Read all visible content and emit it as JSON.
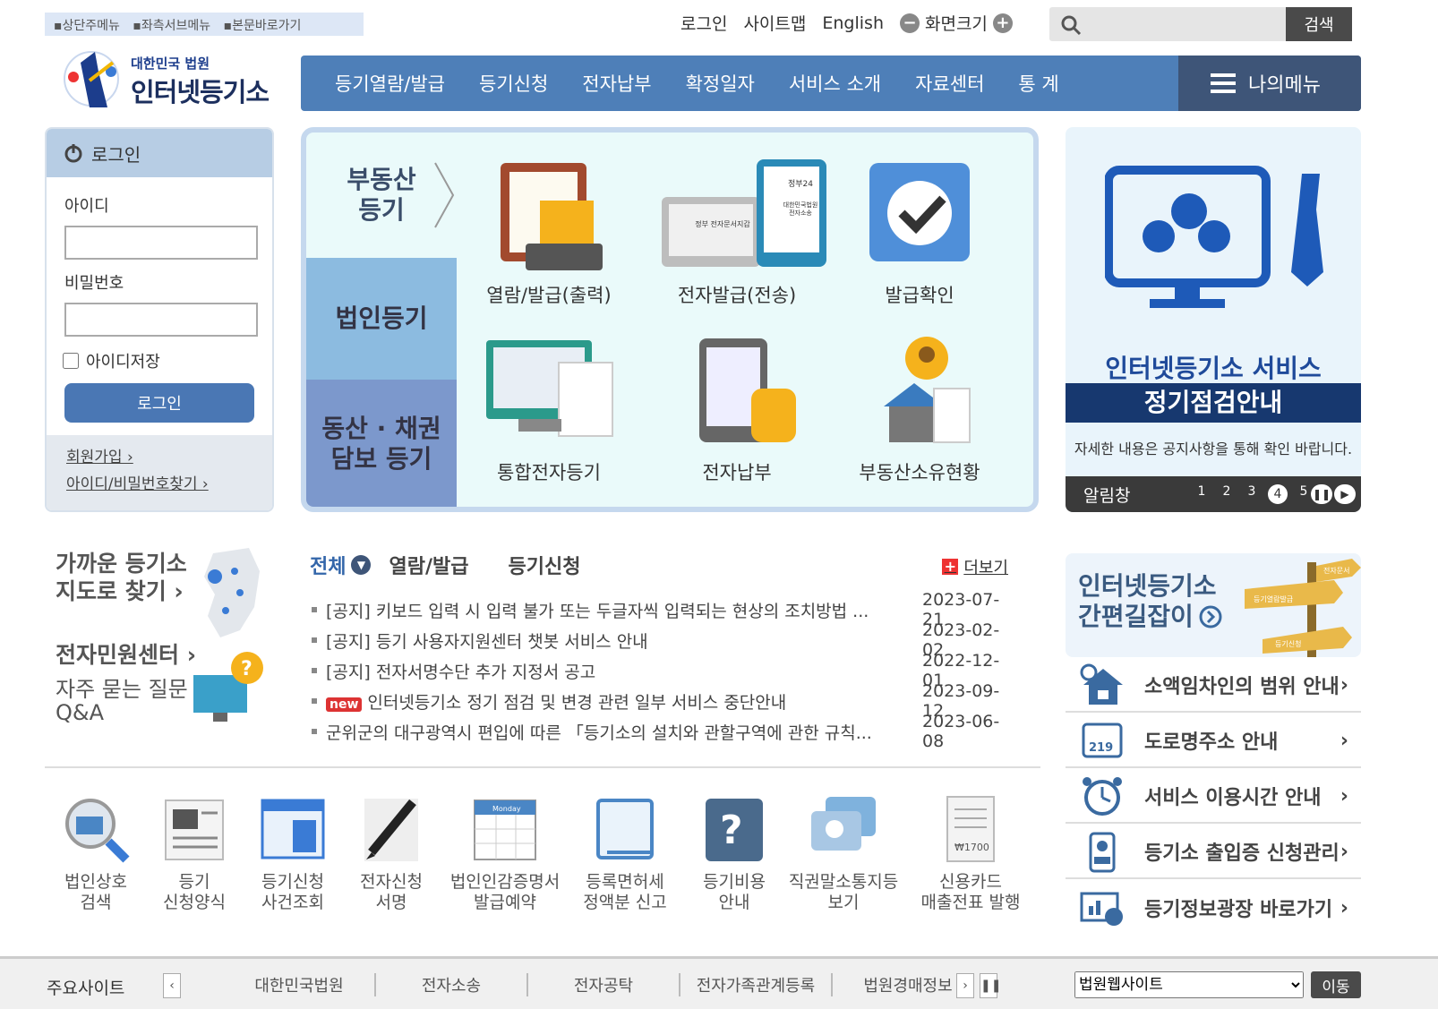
{
  "skip_links": [
    "▪상단주메뉴",
    "▪좌측서브메뉴",
    "▪본문바로가기"
  ],
  "util": {
    "login": "로그인",
    "sitemap": "사이트맵",
    "english": "English",
    "zoom_label": "화면크기"
  },
  "search": {
    "button": "검색",
    "placeholder": ""
  },
  "logo": {
    "court": "대한민국 법원",
    "title": "인터넷등기소"
  },
  "gnb": [
    "등기열람/발급",
    "등기신청",
    "전자납부",
    "확정일자",
    "서비스 소개",
    "자료센터",
    "통 계"
  ],
  "mymenu": "나의메뉴",
  "login": {
    "header": "로그인",
    "id_label": "아이디",
    "pw_label": "비밀번호",
    "save_id": "아이디저장",
    "button": "로그인",
    "join": "회원가입 ›",
    "find": "아이디/비밀번호찾기 ›"
  },
  "quick": {
    "tabs": [
      "부동산\n등기",
      "법인등기",
      "동산 · 채권\n담보 등기"
    ],
    "items": [
      "열람/발급(출력)",
      "전자발급(전송)",
      "발급확인",
      "통합전자등기",
      "전자납부",
      "부동산소유현황"
    ],
    "tile_texts": [
      "정부24",
      "대한민국법원 전자소송",
      "정부 전자문서지갑"
    ]
  },
  "banner": {
    "line1": "인터넷등기소 서비스",
    "line2": "정기점검안내",
    "line3": "자세한 내용은 공지사항을 통해 확인 바랍니다.",
    "bar_label": "알림창",
    "pages": [
      "1",
      "2",
      "3",
      "4",
      "5"
    ],
    "active_page": "4"
  },
  "left_links": {
    "map1": "가까운 등기소",
    "map2": "지도로 찾기 ›",
    "center": "전자민원센터 ›",
    "faq1": "자주 묻는 질문",
    "faq2": "Q&A"
  },
  "news": {
    "tabs": [
      "전체",
      "열람/발급",
      "등기신청"
    ],
    "more": "더보기",
    "new_badge": "new",
    "rows": [
      {
        "title": "[공지] 키보드 입력 시 입력 불가 또는 두글자씩 입력되는 현상의 조치방법 ...",
        "date": "2023-07-21"
      },
      {
        "title": "[공지] 등기 사용자지원센터 챗봇 서비스 안내",
        "date": "2023-02-02"
      },
      {
        "title": "[공지] 전자서명수단 추가 지정서 공고",
        "date": "2022-12-01"
      },
      {
        "title": "인터넷등기소 정기 점검 및 변경 관련 일부 서비스 중단안내",
        "date": "2023-09-12"
      },
      {
        "title": "군위군의 대구광역시 편입에 따른 「등기소의 설치와 관할구역에 관한 규칙...",
        "date": "2023-06-08"
      }
    ]
  },
  "services": [
    [
      "법인상호",
      "검색"
    ],
    [
      "등기",
      "신청양식"
    ],
    [
      "등기신청",
      "사건조회"
    ],
    [
      "전자신청",
      "서명"
    ],
    [
      "법인인감증명서",
      "발급예약"
    ],
    [
      "등록면허세",
      "정액분 신고"
    ],
    [
      "등기비용",
      "안내"
    ],
    [
      "직권말소통지등",
      "보기"
    ],
    [
      "신용카드",
      "매출전표 발행"
    ]
  ],
  "service_tile_texts": {
    "calendar": "Monday",
    "receipt": "₩1700"
  },
  "guide": {
    "line1": "인터넷등기소",
    "line2": "간편길잡이",
    "sign_texts": [
      "전자문서",
      "등기열람발급",
      "등기신청"
    ]
  },
  "links": [
    "소액임차인의 범위 안내",
    "도로명주소 안내",
    "서비스 이용시간 안내",
    "등기소 출입증 신청관리",
    "등기정보광장 바로가기"
  ],
  "link_icon_texts": {
    "road": "219"
  },
  "footer": {
    "title": "주요사이트",
    "sites": [
      "대한민국법원",
      "전자소송",
      "전자공탁",
      "전자가족관계등록",
      "법원경매정보"
    ],
    "select": "법원웹사이트",
    "go": "이동"
  },
  "colors": {
    "nav": "#4e7fb8",
    "nav_dark": "#3e5578",
    "login_header": "#b7cde4",
    "banner_dark": "#17386f"
  }
}
